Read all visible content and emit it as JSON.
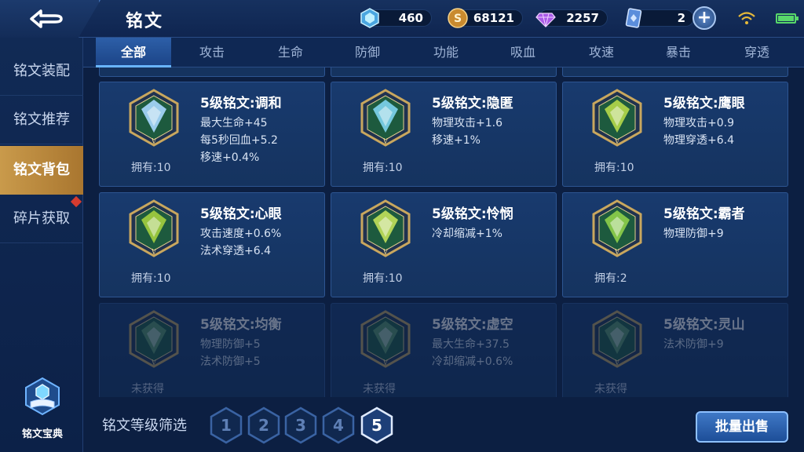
{
  "header": {
    "title": "铭文",
    "currencies": [
      {
        "name": "crystal-icon",
        "value": "460",
        "color": "#8fd8ff"
      },
      {
        "name": "gold-coin-icon",
        "value": "68121",
        "color": "#e0a84a"
      },
      {
        "name": "diamond-icon",
        "value": "2257",
        "color": "#c47cff"
      },
      {
        "name": "rune-card-icon",
        "value": "2",
        "color": "#8fb8ff"
      }
    ],
    "plus": "+"
  },
  "sidebar": {
    "items": [
      {
        "label": "铭文装配"
      },
      {
        "label": "铭文推荐"
      },
      {
        "label": "铭文背包"
      },
      {
        "label": "碎片获取"
      }
    ],
    "codex_label": "铭文宝典"
  },
  "tabs": [
    "全部",
    "攻击",
    "生命",
    "防御",
    "功能",
    "吸血",
    "攻速",
    "暴击",
    "穿透"
  ],
  "runes": [
    {
      "title": "5级铭文:调和",
      "stats": [
        "最大生命+45",
        "每5秒回血+5.2",
        "移速+0.4%"
      ],
      "owned": "拥有:10",
      "color": "#a9d8ff",
      "dim": false
    },
    {
      "title": "5级铭文:隐匿",
      "stats": [
        "物理攻击+1.6",
        "移速+1%"
      ],
      "owned": "拥有:10",
      "color": "#7fd4f0",
      "dim": false
    },
    {
      "title": "5级铭文:鹰眼",
      "stats": [
        "物理攻击+0.9",
        "物理穿透+6.4"
      ],
      "owned": "拥有:10",
      "color": "#b6d94a",
      "dim": false
    },
    {
      "title": "5级铭文:心眼",
      "stats": [
        "攻击速度+0.6%",
        "法术穿透+6.4"
      ],
      "owned": "拥有:10",
      "color": "#a4cf3e",
      "dim": false
    },
    {
      "title": "5级铭文:怜悯",
      "stats": [
        "冷却缩减+1%"
      ],
      "owned": "拥有:10",
      "color": "#c2e05a",
      "dim": false
    },
    {
      "title": "5级铭文:霸者",
      "stats": [
        "物理防御+9"
      ],
      "owned": "拥有:2",
      "color": "#8fd04a",
      "dim": false
    },
    {
      "title": "5级铭文:均衡",
      "stats": [
        "物理防御+5",
        "法术防御+5"
      ],
      "owned": "未获得",
      "color": "#5fa06a",
      "dim": true
    },
    {
      "title": "5级铭文:虚空",
      "stats": [
        "最大生命+37.5",
        "冷却缩减+0.6%"
      ],
      "owned": "未获得",
      "color": "#5fa06a",
      "dim": true
    },
    {
      "title": "5级铭文:灵山",
      "stats": [
        "法术防御+9"
      ],
      "owned": "未获得",
      "color": "#5fa06a",
      "dim": true
    }
  ],
  "filter": {
    "label": "铭文等级筛选",
    "levels": [
      "1",
      "2",
      "3",
      "4",
      "5"
    ],
    "selected": "5"
  },
  "sell_button": "批量出售"
}
